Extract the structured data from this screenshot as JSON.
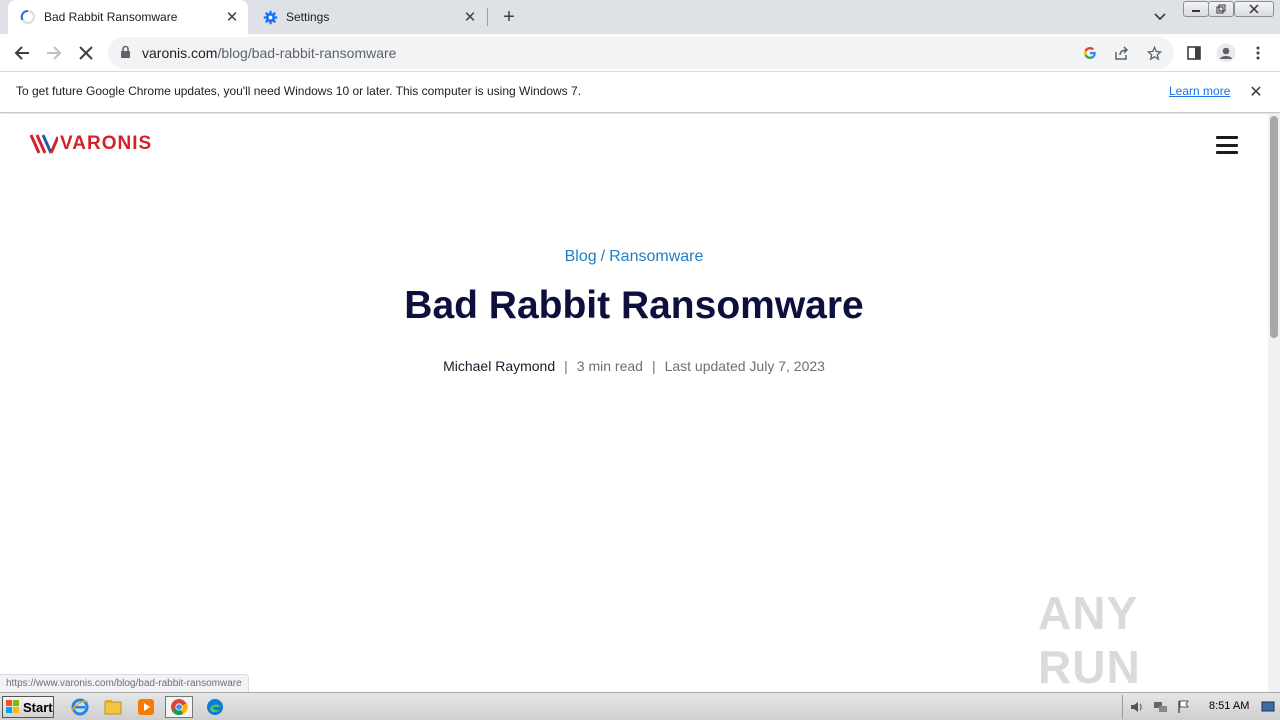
{
  "tabs": [
    {
      "title": "Bad Rabbit Ransomware",
      "icon": "loading-spinner-icon",
      "active": true
    },
    {
      "title": "Settings",
      "icon": "gear-icon",
      "active": false
    }
  ],
  "toolbar": {
    "url_host": "varonis.com",
    "url_path": "/blog/bad-rabbit-ransomware"
  },
  "infobar": {
    "message": "To get future Google Chrome updates, you'll need Windows 10 or later. This computer is using Windows 7.",
    "link": "Learn more"
  },
  "page": {
    "logo_text": "VARONIS",
    "breadcrumb": {
      "first": "Blog",
      "separator": "/",
      "second": "Ransomware"
    },
    "headline": "Bad Rabbit Ransomware",
    "meta": {
      "author": "Michael Raymond",
      "read_time": "3 min read",
      "updated": "Last updated July 7, 2023"
    }
  },
  "status_url": "https://www.varonis.com/blog/bad-rabbit-ransomware",
  "watermark": "ANY RUN",
  "taskbar": {
    "start_label": "Start",
    "clock": "8:51 AM"
  },
  "colors": {
    "brand_red": "#d3222a",
    "link_blue": "#1f7ec5",
    "headline_navy": "#0d0f3d"
  }
}
